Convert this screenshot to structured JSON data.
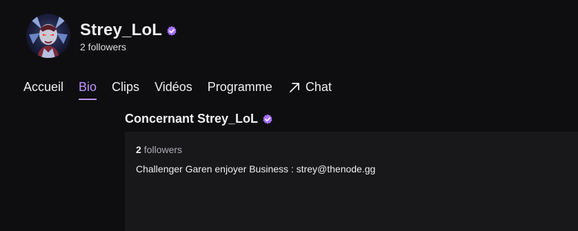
{
  "channel": {
    "name": "Strey_LoL",
    "followers_text": "2 followers",
    "verified_icon": "verified-badge-icon",
    "avatar_icon": "avatar"
  },
  "tabs": [
    {
      "label": "Accueil",
      "active": false
    },
    {
      "label": "Bio",
      "active": true
    },
    {
      "label": "Clips",
      "active": false
    },
    {
      "label": "Vidéos",
      "active": false
    },
    {
      "label": "Programme",
      "active": false
    },
    {
      "label": "Chat",
      "active": false,
      "icon": "external-link-icon"
    }
  ],
  "about": {
    "title": "Concernant Strey_LoL",
    "followers_count": "2",
    "followers_label": "followers",
    "description": "Challenger Garen enjoyer Business : strey@thenode.gg"
  },
  "colors": {
    "background": "#0e0e10",
    "panel": "#18181b",
    "accent": "#bf94ff",
    "verified": "#a970ff"
  }
}
